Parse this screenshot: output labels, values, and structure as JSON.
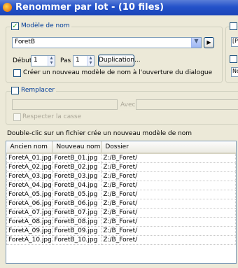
{
  "window": {
    "title": "Renommer par lot - (10 files)"
  },
  "name_model": {
    "checkbox_label": "Modèle de nom",
    "checked": true,
    "pattern_value": "ForetB",
    "start_label": "Début",
    "start_value": "1",
    "step_label": "Pas",
    "step_value": "1",
    "duplication_label": "Duplication...",
    "new_model_label": "Créer un nouveau modèle de nom à l'ouverture du dialogue",
    "play_icon": "play-icon"
  },
  "replace": {
    "checkbox_label": "Remplacer",
    "with_label": "Avec",
    "case_label": "Respecter la casse"
  },
  "hint_text": "Double-clic sur un fichier crée un nouveau modèle de nom",
  "file_list": {
    "columns": [
      "Ancien nom",
      "Nouveau nom",
      "Dossier"
    ],
    "rows": [
      [
        "ForetA_01.jpg",
        "ForetB_01.jpg",
        "Z:/B_Foret/"
      ],
      [
        "ForetA_02.jpg",
        "ForetB_02.jpg",
        "Z:/B_Foret/"
      ],
      [
        "ForetA_03.jpg",
        "ForetB_03.jpg",
        "Z:/B_Foret/"
      ],
      [
        "ForetA_04.jpg",
        "ForetB_04.jpg",
        "Z:/B_Foret/"
      ],
      [
        "ForetA_05.jpg",
        "ForetB_05.jpg",
        "Z:/B_Foret/"
      ],
      [
        "ForetA_06.jpg",
        "ForetB_06.jpg",
        "Z:/B_Foret/"
      ],
      [
        "ForetA_07.jpg",
        "ForetB_07.jpg",
        "Z:/B_Foret/"
      ],
      [
        "ForetA_08.jpg",
        "ForetB_08.jpg",
        "Z:/B_Foret/"
      ],
      [
        "ForetA_09.jpg",
        "ForetB_09.jpg",
        "Z:/B_Foret/"
      ],
      [
        "ForetA_10.jpg",
        "ForetB_10.jpg",
        "Z:/B_Foret/"
      ]
    ]
  },
  "right_panel": {
    "cut_text_1": "[P",
    "cut_text_2": "No"
  },
  "colors": {
    "titlebar": "#2452c9",
    "window_bg": "#ece9d8",
    "group_label": "#003c9a"
  }
}
